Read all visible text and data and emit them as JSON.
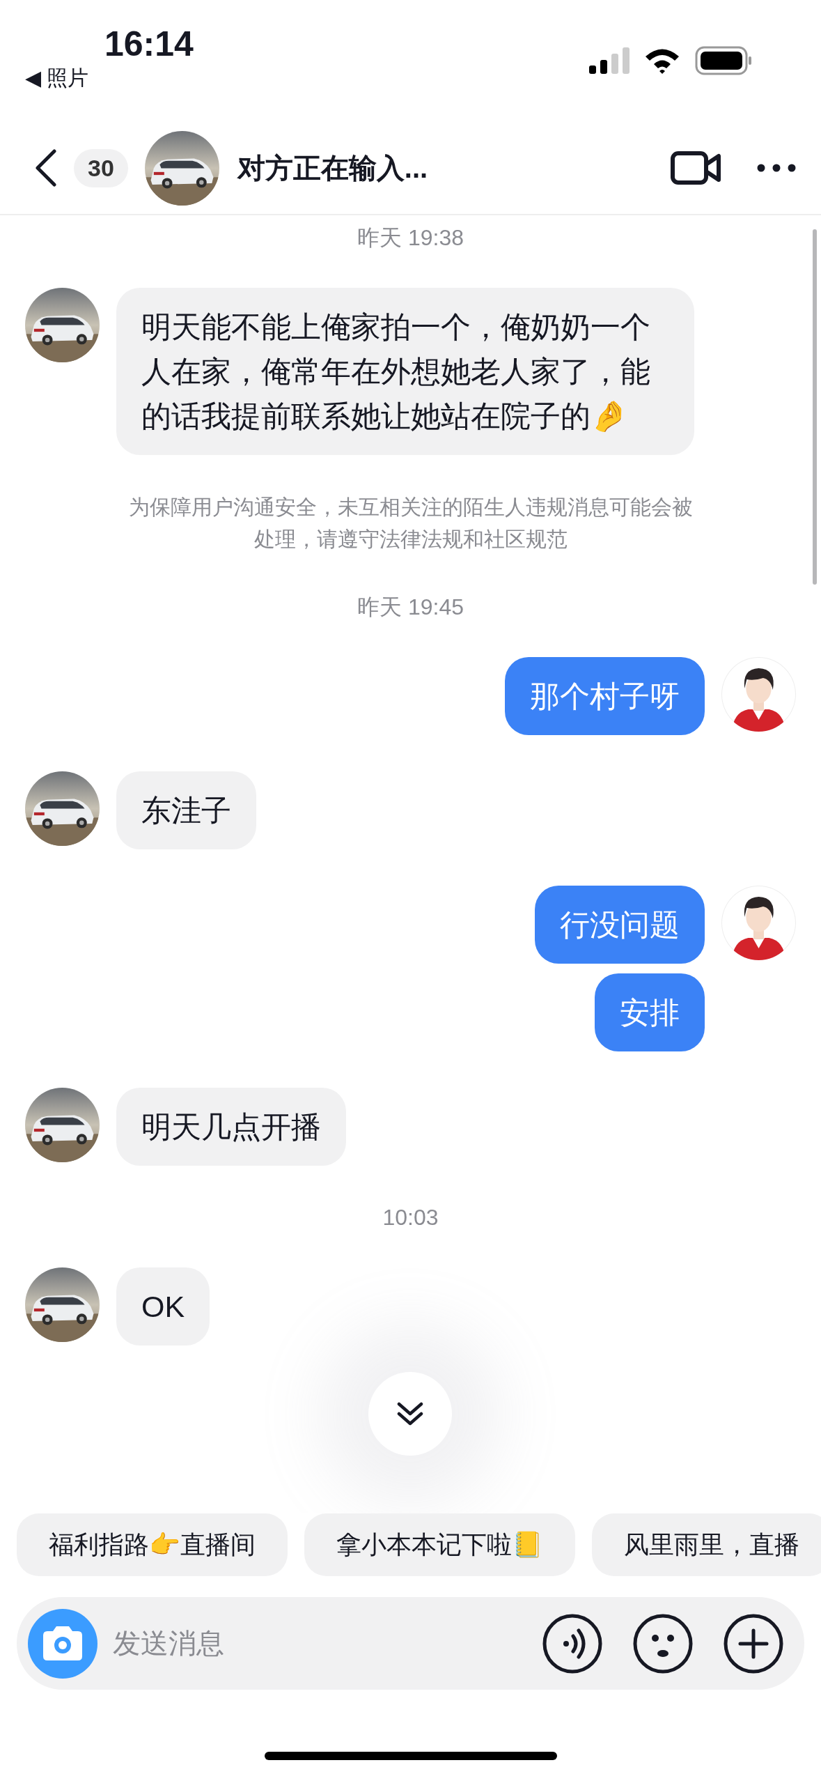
{
  "status_bar": {
    "time": "16:14",
    "back_app": "◀ 照片"
  },
  "header": {
    "unread_count": "30",
    "title": "对方正在输入..."
  },
  "messages": [
    {
      "kind": "time",
      "text": "昨天 19:38"
    },
    {
      "kind": "incoming",
      "text": "明天能不能上俺家拍一个，俺奶奶一个人在家，俺常年在外想她老人家了，能的话我提前联系她让她站在院子的🤌"
    },
    {
      "kind": "notice",
      "text": "为保障用户沟通安全，未互相关注的陌生人违规消息可能会被处理，请遵守法律法规和社区规范"
    },
    {
      "kind": "time",
      "text": "昨天 19:45"
    },
    {
      "kind": "outgoing",
      "text": "那个村子呀",
      "show_avatar": true
    },
    {
      "kind": "incoming",
      "text": "东洼子"
    },
    {
      "kind": "outgoing",
      "text": "行没问题",
      "show_avatar": true
    },
    {
      "kind": "outgoing",
      "text": "安排",
      "show_avatar": false
    },
    {
      "kind": "incoming",
      "text": "明天几点开播"
    },
    {
      "kind": "time",
      "text": "10:03"
    },
    {
      "kind": "incoming",
      "text": "OK"
    }
  ],
  "quick_replies": [
    "福利指路👉直播间",
    "拿小本本记下啦📒",
    "风里雨里，直播"
  ],
  "input": {
    "placeholder": "发送消息"
  }
}
